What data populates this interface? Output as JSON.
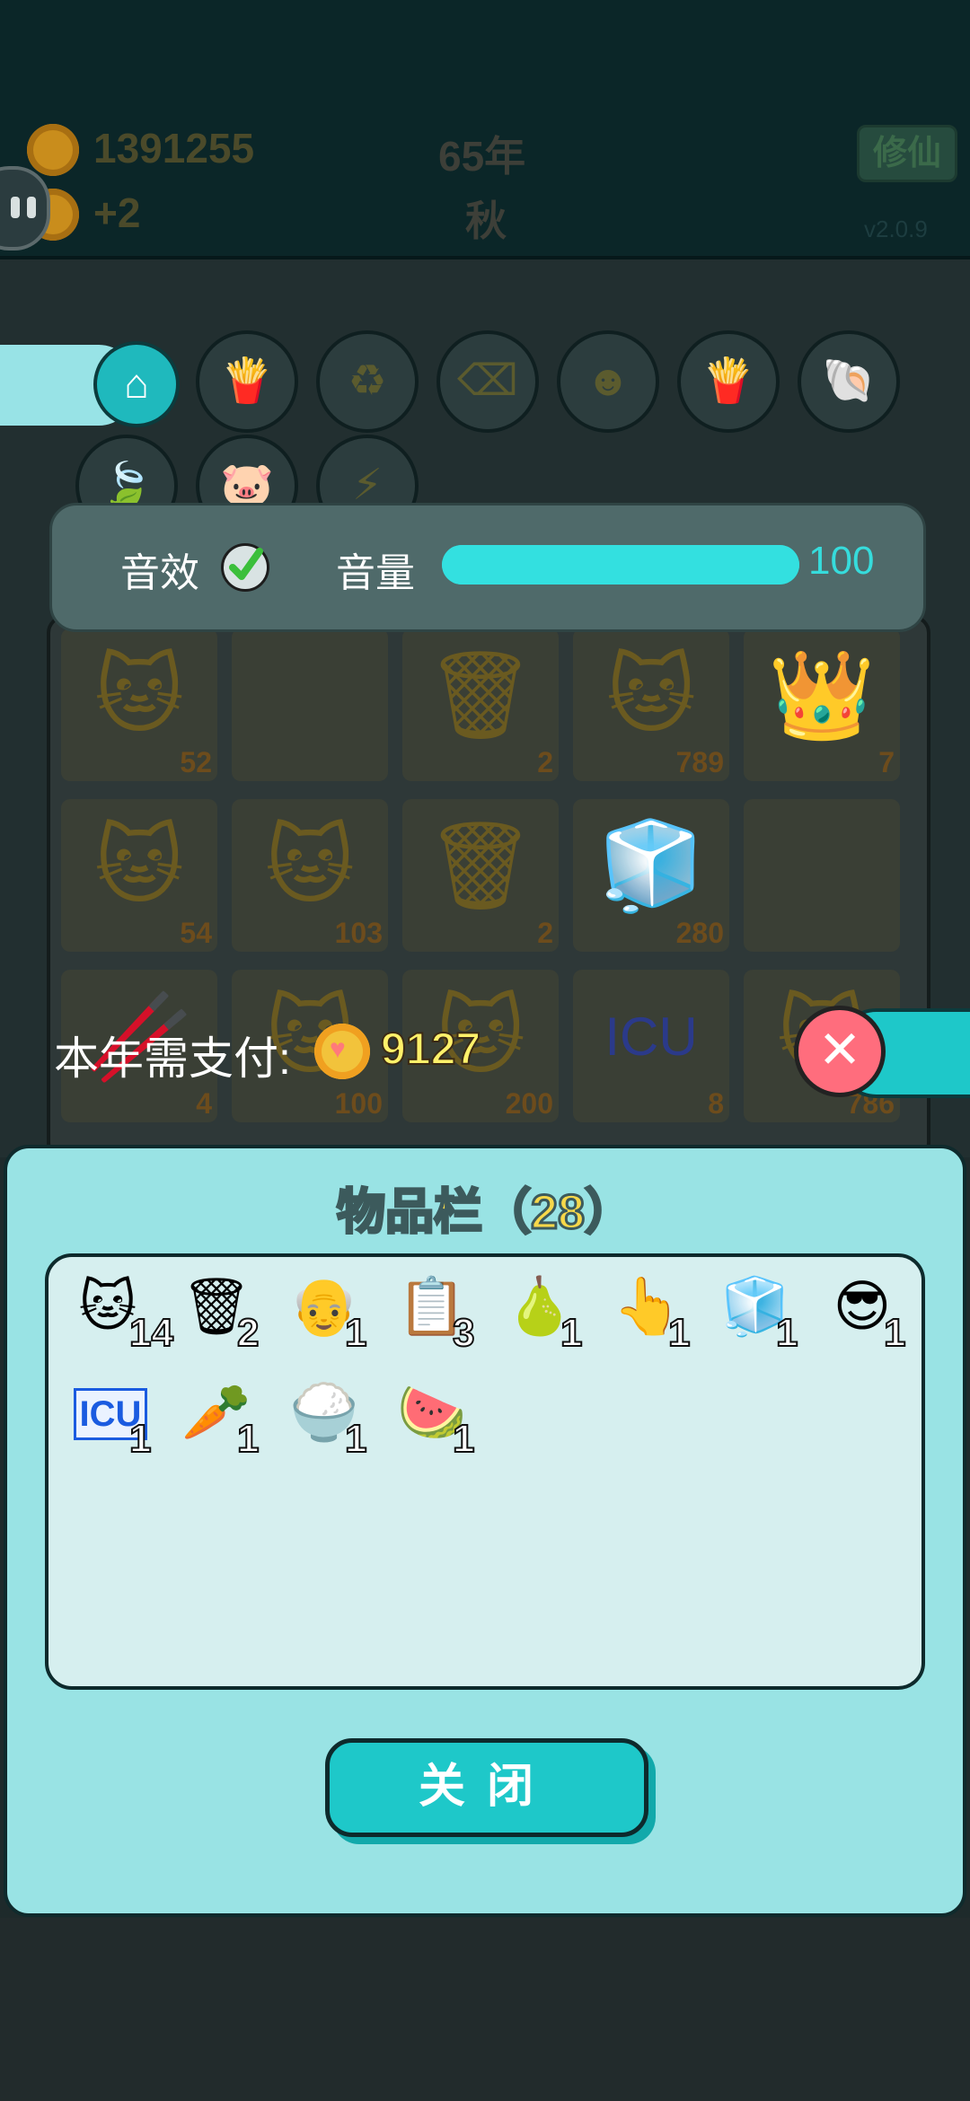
{
  "header": {
    "coins": "1391255",
    "income": "+2",
    "year": "65年",
    "season": "秋",
    "xiuxian_label": "修仙",
    "version": "v2.0.9"
  },
  "board": {
    "cells": [
      {
        "icon": "🐱",
        "count": "52"
      },
      {
        "icon": "",
        "count": ""
      },
      {
        "icon": "🗑",
        "count": "2"
      },
      {
        "icon": "🐱",
        "count": "789"
      },
      {
        "icon": "👑",
        "count": "7"
      },
      {
        "icon": "🐱",
        "count": "54"
      },
      {
        "icon": "🐱",
        "count": "103"
      },
      {
        "icon": "🗑",
        "count": "2"
      },
      {
        "icon": "🧊",
        "count": "280"
      },
      {
        "icon": "",
        "count": ""
      },
      {
        "icon": "🥢",
        "count": "4"
      },
      {
        "icon": "🐱",
        "count": "100"
      },
      {
        "icon": "🐱",
        "count": "200"
      },
      {
        "icon": "ICU",
        "count": "8"
      },
      {
        "icon": "🐱",
        "count": "786"
      }
    ]
  },
  "settings": {
    "sound_label": "音效",
    "volume_label": "音量",
    "volume_value": "100",
    "volume_fraction": 1.0
  },
  "payment": {
    "label": "本年需支付:",
    "amount": "9127"
  },
  "inventory": {
    "title": "物品栏（28）",
    "items": [
      {
        "name": "cat",
        "icon": "🐱",
        "count": "14"
      },
      {
        "name": "garbage-bag",
        "icon": "🗑",
        "count": "2"
      },
      {
        "name": "old-man",
        "icon": "👴",
        "count": "1"
      },
      {
        "name": "ctrl-c-ctrl-v",
        "icon": "📋",
        "count": "3"
      },
      {
        "name": "pear",
        "icon": "🍐",
        "count": "1"
      },
      {
        "name": "hand-pointer",
        "icon": "👆",
        "count": "1"
      },
      {
        "name": "fridge",
        "icon": "🧊",
        "count": "1"
      },
      {
        "name": "sunglasses-man",
        "icon": "😎",
        "count": "1"
      },
      {
        "name": "icu",
        "icon": "ICU",
        "count": "1"
      },
      {
        "name": "carrot",
        "icon": "🥕",
        "count": "1"
      },
      {
        "name": "rice-bowl",
        "icon": "🍚",
        "count": "1"
      },
      {
        "name": "watermelon",
        "icon": "🍉",
        "count": "1"
      }
    ],
    "close_label": "关闭"
  }
}
